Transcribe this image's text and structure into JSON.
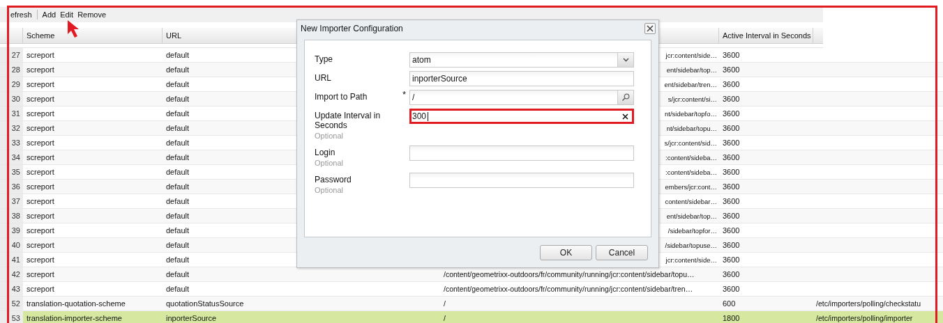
{
  "toolbar": {
    "buttons": [
      {
        "label": "efresh"
      },
      {
        "label": "Add"
      },
      {
        "label": "Edit"
      },
      {
        "label": "Remove"
      }
    ]
  },
  "table": {
    "columns": [
      "Scheme",
      "URL",
      "Active Interval in Seconds"
    ],
    "rows": [
      {
        "number": "27",
        "scheme": "screport",
        "url": "default",
        "path": "jcr:content/side…",
        "interval": "3600",
        "selected": false
      },
      {
        "number": "28",
        "scheme": "screport",
        "url": "default",
        "path": "ent/sidebar/top…",
        "interval": "3600",
        "selected": false
      },
      {
        "number": "29",
        "scheme": "screport",
        "url": "default",
        "path": "ent/sidebar/tren…",
        "interval": "3600",
        "selected": false
      },
      {
        "number": "30",
        "scheme": "screport",
        "url": "default",
        "path": "s/jcr:content/si…",
        "interval": "3600",
        "selected": false
      },
      {
        "number": "31",
        "scheme": "screport",
        "url": "default",
        "path": "nt/sidebar/topfo…",
        "interval": "3600",
        "selected": false
      },
      {
        "number": "32",
        "scheme": "screport",
        "url": "default",
        "path": "nt/sidebar/topu…",
        "interval": "3600",
        "selected": false
      },
      {
        "number": "33",
        "scheme": "screport",
        "url": "default",
        "path": "s/jcr:content/sid…",
        "interval": "3600",
        "selected": false
      },
      {
        "number": "34",
        "scheme": "screport",
        "url": "default",
        "path": ":content/sideba…",
        "interval": "3600",
        "selected": false
      },
      {
        "number": "35",
        "scheme": "screport",
        "url": "default",
        "path": ":content/sideba…",
        "interval": "3600",
        "selected": false
      },
      {
        "number": "36",
        "scheme": "screport",
        "url": "default",
        "path": "embers/jcr:cont…",
        "interval": "3600",
        "selected": false
      },
      {
        "number": "37",
        "scheme": "screport",
        "url": "default",
        "path": "content/sidebar…",
        "interval": "3600",
        "selected": false
      },
      {
        "number": "38",
        "scheme": "screport",
        "url": "default",
        "path": "ent/sidebar/top…",
        "interval": "3600",
        "selected": false
      },
      {
        "number": "39",
        "scheme": "screport",
        "url": "default",
        "path": "/sidebar/topfor…",
        "interval": "3600",
        "selected": false
      },
      {
        "number": "40",
        "scheme": "screport",
        "url": "default",
        "path": "/sidebar/topuse…",
        "interval": "3600",
        "selected": false
      },
      {
        "number": "41",
        "scheme": "screport",
        "url": "default",
        "path": "jcr:content/side…",
        "interval": "3600",
        "selected": false
      },
      {
        "number": "42",
        "scheme": "screport",
        "url": "default",
        "path": "/content/geometrixx-outdoors/fr/community/running/jcr:content/sidebar/topu…",
        "interval": "3600",
        "selected": false
      },
      {
        "number": "43",
        "scheme": "screport",
        "url": "default",
        "path": "/content/geometrixx-outdoors/fr/community/running/jcr:content/sidebar/tren…",
        "interval": "3600",
        "selected": false
      },
      {
        "number": "52",
        "scheme": "translation-quotation-scheme",
        "url": "quotationStatusSource",
        "path": "/",
        "interval": "600",
        "column_5": "/etc/importers/polling/checkstatu",
        "selected": false
      },
      {
        "number": "53",
        "scheme": "translation-importer-scheme",
        "url": "inporterSource",
        "path": "/",
        "interval": "1800",
        "column_5": "/etc/importers/polling/importer",
        "selected": true
      }
    ]
  },
  "dialog": {
    "title": "New Importer Configuration",
    "fields": [
      {
        "label": "Type",
        "kind": "select",
        "value": "atom",
        "highlighted": false
      },
      {
        "label": "URL",
        "kind": "text",
        "value": "inporterSource",
        "highlighted": false
      },
      {
        "label": "Import to Path",
        "kind": "search",
        "required_mark": "*",
        "value": "/",
        "highlighted": false
      },
      {
        "label": "Update Interval in Seconds",
        "kind": "clear",
        "hint": "Optional",
        "value": "300",
        "highlighted": true
      },
      {
        "label": "Login",
        "kind": "text",
        "hint": "Optional",
        "highlighted": false
      },
      {
        "label": "Password",
        "kind": "text",
        "hint": "Optional",
        "highlighted": false
      }
    ],
    "buttons": [
      {
        "label": "OK"
      },
      {
        "label": "Cancel"
      }
    ]
  }
}
